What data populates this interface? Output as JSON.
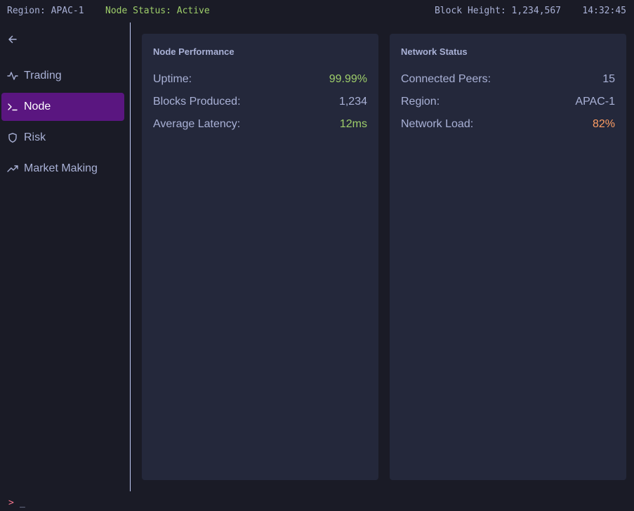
{
  "topbar": {
    "region": "Region: APAC-1",
    "node_status": "Node Status: Active",
    "block_height": "Block Height: 1,234,567",
    "time": "14:32:45"
  },
  "sidebar": {
    "back_icon": "arrow-left-icon",
    "items": [
      {
        "label": "Trading",
        "icon": "activity-icon",
        "active": false
      },
      {
        "label": "Node",
        "icon": "terminal-icon",
        "active": true
      },
      {
        "label": "Risk",
        "icon": "shield-icon",
        "active": false
      },
      {
        "label": "Market Making",
        "icon": "trending-up-icon",
        "active": false
      }
    ]
  },
  "node_performance": {
    "title": "Node Performance",
    "rows": [
      {
        "label": "Uptime:",
        "value": "99.99%"
      },
      {
        "label": "Blocks Produced:",
        "value": "1,234"
      },
      {
        "label": "Average Latency:",
        "value": "12ms"
      }
    ]
  },
  "network_status": {
    "title": "Network Status",
    "rows": [
      {
        "label": "Connected Peers:",
        "value": "15"
      },
      {
        "label": "Region:",
        "value": "APAC-1"
      },
      {
        "label": "Network Load:",
        "value": "82%"
      }
    ]
  },
  "command_line": {
    "prompt": ">",
    "cursor": "_"
  },
  "colors": {
    "background": "#1a1b26",
    "card": "#24283b",
    "accent": "#5a1680",
    "success": "#9ece6a",
    "warning": "#ff9e64",
    "prompt": "#f7768e"
  }
}
